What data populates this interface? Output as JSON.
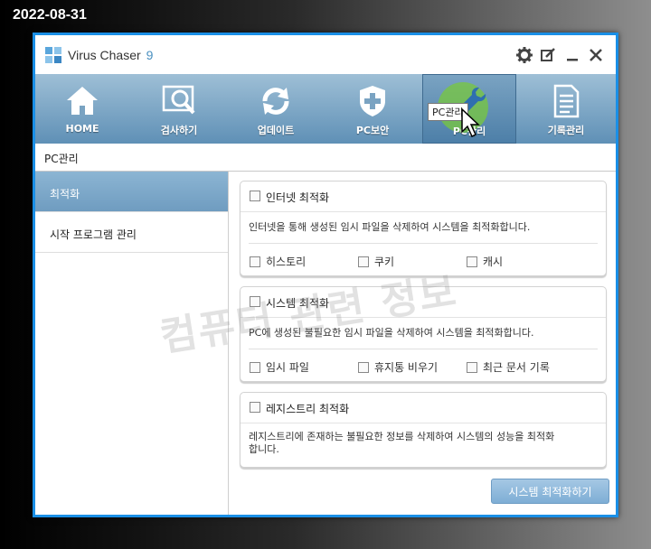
{
  "date_stamp": "2022-08-31",
  "window": {
    "app_name": "Virus Chaser",
    "app_version": "9"
  },
  "nav": {
    "items": [
      {
        "label": "HOME",
        "icon": "home-icon"
      },
      {
        "label": "검사하기",
        "icon": "scan-magnifier-icon"
      },
      {
        "label": "업데이트",
        "icon": "refresh-icon"
      },
      {
        "label": "PC보안",
        "icon": "shield-plus-icon"
      },
      {
        "label": "PC관리",
        "icon": "wrench-icon"
      },
      {
        "label": "기록관리",
        "icon": "document-icon"
      }
    ],
    "active_index": 4,
    "tooltip": "PC관리"
  },
  "breadcrumb": "PC관리",
  "sidebar": {
    "items": [
      {
        "label": "최적화"
      },
      {
        "label": "시작 프로그램 관리"
      }
    ]
  },
  "sections": {
    "internet": {
      "title": "인터넷 최적화",
      "desc": "인터넷을 통해 생성된 임시 파일을 삭제하여 시스템을 최적화합니다.",
      "options": [
        "히스토리",
        "쿠키",
        "캐시"
      ]
    },
    "system": {
      "title": "시스템 최적화",
      "desc": "PC에 생성된 불필요한 임시 파일을 삭제하여 시스템을 최적화합니다.",
      "options": [
        "임시 파일",
        "휴지통 비우기",
        "최근 문서 기록"
      ]
    },
    "registry": {
      "title": "레지스트리 최적화",
      "desc1": "레지스트리에 존재하는 불필요한 정보를 삭제하여 시스템의 성능을 최적화",
      "desc2": "합니다."
    }
  },
  "optimize_button": "시스템 최적화하기",
  "watermark": "컴퓨터 관련 정보",
  "colors": {
    "window_border": "#1a8fe6",
    "nav_top": "#9ebfd6",
    "nav_bottom": "#5f90b6",
    "cursor_highlight": "#78c83c"
  }
}
